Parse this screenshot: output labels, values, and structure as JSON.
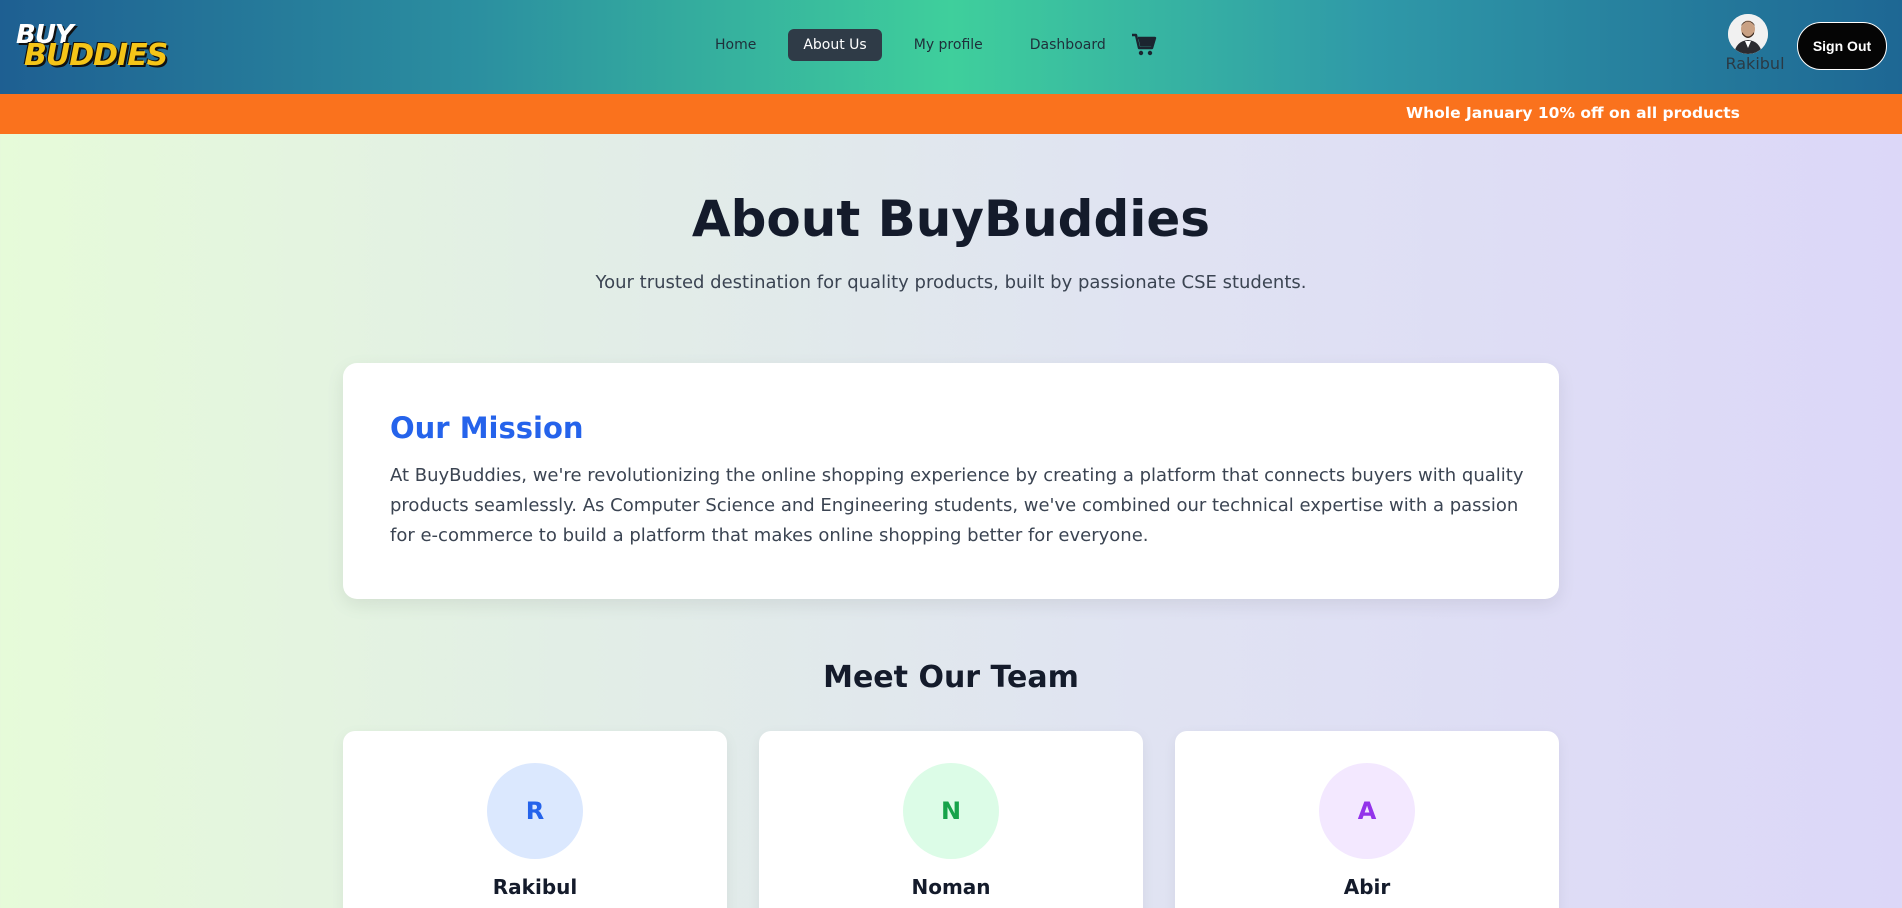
{
  "brand": {
    "logo_top": "BUY",
    "logo_bottom": "BUDDIES"
  },
  "nav": {
    "items": [
      {
        "label": "Home",
        "active": false
      },
      {
        "label": "About Us",
        "active": true
      },
      {
        "label": "My profile",
        "active": false
      },
      {
        "label": "Dashboard",
        "active": false
      }
    ],
    "cart_icon": "shopping-cart-icon"
  },
  "user": {
    "name": "Rakibul",
    "avatar_icon": "user-photo"
  },
  "signout_label": "Sign Out",
  "promo": {
    "text": "Whole January 10% off on all products",
    "color": "#fa721d"
  },
  "hero": {
    "title": "About BuyBuddies",
    "subtitle": "Your trusted destination for quality products, built by passionate CSE students."
  },
  "mission": {
    "title": "Our Mission",
    "text": "At BuyBuddies, we're revolutionizing the online shopping experience by creating a platform that connects buyers with quality products seamlessly. As Computer Science and Engineering students, we've combined our technical expertise with a passion for e-commerce to build a platform that makes online shopping better for everyone."
  },
  "team": {
    "title": "Meet Our Team",
    "members": [
      {
        "initial": "R",
        "name": "Rakibul",
        "color": "#2563eb",
        "bg": "#dbe8fe"
      },
      {
        "initial": "N",
        "name": "Noman",
        "color": "#16a34a",
        "bg": "#dcfce7"
      },
      {
        "initial": "A",
        "name": "Abir",
        "color": "#9333ea",
        "bg": "#f3e8ff"
      }
    ]
  },
  "colors": {
    "accent": "#2563eb",
    "nav_active": "#2f3b47"
  }
}
